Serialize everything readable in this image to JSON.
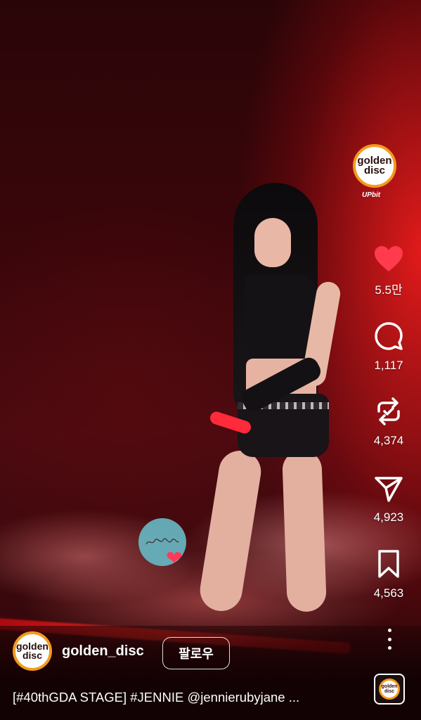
{
  "post": {
    "account_logo_top": {
      "line1": "golden",
      "line2": "disc",
      "sponsor": "UPbit"
    },
    "username": "golden_disc",
    "follow_label": "팔로우",
    "caption": "[#40thGDA STAGE] #JENNIE @jennierubyjane ...",
    "avatar": {
      "line1": "golden",
      "line2": "disc"
    },
    "audio_thumb": {
      "line1": "golden",
      "line2": "disc"
    }
  },
  "actions": {
    "like_count": "5.5만",
    "comment_count": "1,117",
    "repost_count": "4,374",
    "share_count": "4,923",
    "save_count": "4,563"
  },
  "colors": {
    "like": "#ff3b4d",
    "brand_ring": "#f39a1c",
    "stage_red": "#ff2a20"
  },
  "icons": [
    "heart-icon",
    "comment-icon",
    "repost-icon",
    "send-icon",
    "bookmark-icon",
    "more-icon"
  ]
}
